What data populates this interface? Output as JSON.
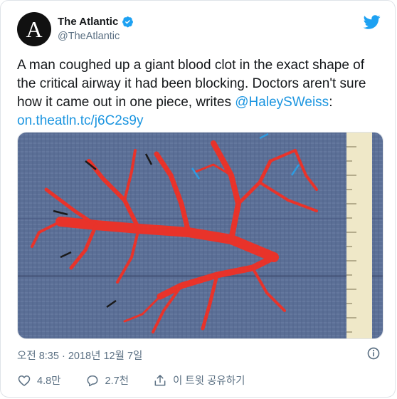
{
  "author": {
    "avatar_letter": "A",
    "display_name": "The Atlantic",
    "handle": "@TheAtlantic",
    "verified": true
  },
  "tweet": {
    "text_main": "A man coughed up a giant blood clot in the exact shape of the critical airway it had been blocking. Doctors aren't sure how it came out in one piece, writes ",
    "mention": "@HaleySWeiss",
    "after_mention": ":",
    "link": "on.theatln.tc/j6C2s9y"
  },
  "meta": {
    "timestamp": "오전 8:35 · 2018년 12월 7일"
  },
  "actions": {
    "likes": "4.8만",
    "replies": "2.7천",
    "share": "이 트윗 공유하기"
  },
  "colors": {
    "brand_blue": "#1da1f2",
    "link_blue": "#1b95e0",
    "clot_red": "#e8332a",
    "cloth_blue": "#5b6f96"
  },
  "icons": [
    "verified-icon",
    "twitter-bird-icon",
    "info-icon",
    "heart-icon",
    "reply-icon",
    "share-icon"
  ]
}
